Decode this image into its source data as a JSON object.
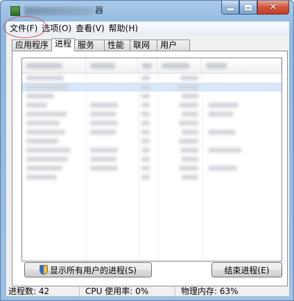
{
  "window": {
    "title_tail": "器",
    "close_glyph": "✕"
  },
  "menu": {
    "items": [
      "文件(F)",
      "选项(O)",
      "查看(V)",
      "帮助(H)"
    ]
  },
  "tabs": [
    "应用程序",
    "进程",
    "服务",
    "性能",
    "联网",
    "用户"
  ],
  "active_tab": "进程",
  "buttons": {
    "show_all": "显示所有用户的进程(S)",
    "end_process": "结束进程(E)"
  },
  "status": {
    "process_count": "进程数: 42",
    "cpu_usage": "CPU 使用率: 0%",
    "memory": "物理内存: 63%"
  },
  "colors": {
    "title_gradient_top": "#a9c9ea",
    "selected_row": "#d7e6f8",
    "annotation_circle": "#d0505a"
  }
}
